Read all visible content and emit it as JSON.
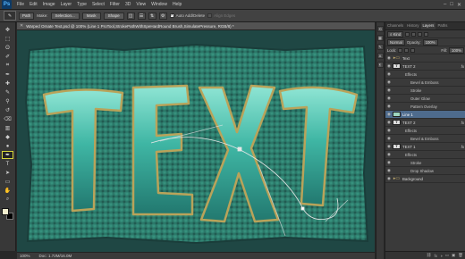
{
  "app": {
    "logo": "Ps",
    "menu": [
      "File",
      "Edit",
      "Image",
      "Layer",
      "Type",
      "Select",
      "Filter",
      "3D",
      "View",
      "Window",
      "Help"
    ],
    "window_controls": [
      "–",
      "□",
      "✕"
    ]
  },
  "options_bar": {
    "tool_preset": "✎",
    "mode_select": "Path",
    "make_label": "Make:",
    "selection_button": "Selection...",
    "mask_button": "Mask",
    "shape_button": "Shape",
    "auto_add_delete_label": "Auto Add/Delete",
    "auto_add_delete_checked": true,
    "align_edges_label": "Align Edges",
    "align_edges_checked": false
  },
  "tools": [
    {
      "name": "move-tool",
      "glyph": "✥"
    },
    {
      "name": "marquee-tool",
      "glyph": "⬚"
    },
    {
      "name": "lasso-tool",
      "glyph": "ʘ"
    },
    {
      "name": "quick-select-tool",
      "glyph": "✐"
    },
    {
      "name": "crop-tool",
      "glyph": "⌗"
    },
    {
      "name": "eyedropper-tool",
      "glyph": "✒"
    },
    {
      "name": "healing-tool",
      "glyph": "✚"
    },
    {
      "name": "brush-tool",
      "glyph": "✎"
    },
    {
      "name": "clone-stamp-tool",
      "glyph": "⚲"
    },
    {
      "name": "history-brush-tool",
      "glyph": "↺"
    },
    {
      "name": "eraser-tool",
      "glyph": "⌫"
    },
    {
      "name": "gradient-tool",
      "glyph": "▥"
    },
    {
      "name": "blur-tool",
      "glyph": "◆"
    },
    {
      "name": "dodge-tool",
      "glyph": "●"
    },
    {
      "name": "pen-tool",
      "glyph": "✒",
      "active": true
    },
    {
      "name": "type-tool",
      "glyph": "T"
    },
    {
      "name": "path-select-tool",
      "glyph": "➤"
    },
    {
      "name": "shape-tool",
      "glyph": "▭"
    },
    {
      "name": "hand-tool",
      "glyph": "✋"
    },
    {
      "name": "zoom-tool",
      "glyph": "⌕"
    }
  ],
  "colors": {
    "foreground": "#f3efcf",
    "background": "#000000",
    "canvas_bg": "#2b7768",
    "accent_selected": "#4e6b8d"
  },
  "document": {
    "tab_title": "Warped Ornate Text.psd @ 100% (Line 1 ProTool,StrokePathWithSpeHardRound Brush,SimulatePressure, RGB/8) *",
    "canvas_text": "TEXT",
    "zoom": "100%",
    "doc_size": "Doc: 1.72M/16.0M"
  },
  "panels": {
    "tabs": [
      "Channels",
      "History",
      "Layers",
      "Paths"
    ],
    "active_tab": "Layers",
    "kind_select": "Kind",
    "blend_mode": "Normal",
    "opacity_label": "Opacity:",
    "opacity_value": "100%",
    "lock_label": "Lock:",
    "fill_label": "Fill:",
    "fill_value": "100%",
    "layers": [
      {
        "label": "Text",
        "type": "group"
      },
      {
        "label": "TEXT 2",
        "type": "text",
        "fx": "fx"
      },
      {
        "label": "Effects",
        "type": "sub"
      },
      {
        "label": "Bevel & Emboss",
        "type": "sub2"
      },
      {
        "label": "Stroke",
        "type": "sub2"
      },
      {
        "label": "Outer Glow",
        "type": "sub2"
      },
      {
        "label": "Pattern Overlay",
        "type": "sub2"
      },
      {
        "label": "Line 1",
        "type": "layer",
        "selected": true
      },
      {
        "label": "TEXT 2",
        "type": "text",
        "fx": "fx"
      },
      {
        "label": "Effects",
        "type": "sub"
      },
      {
        "label": "Bevel & Emboss",
        "type": "sub2"
      },
      {
        "label": "TEXT 1",
        "type": "text",
        "fx": "fx"
      },
      {
        "label": "Effects",
        "type": "sub"
      },
      {
        "label": "Stroke",
        "type": "sub2"
      },
      {
        "label": "Drop Shadow",
        "type": "sub2"
      },
      {
        "label": "Background",
        "type": "group"
      }
    ]
  }
}
